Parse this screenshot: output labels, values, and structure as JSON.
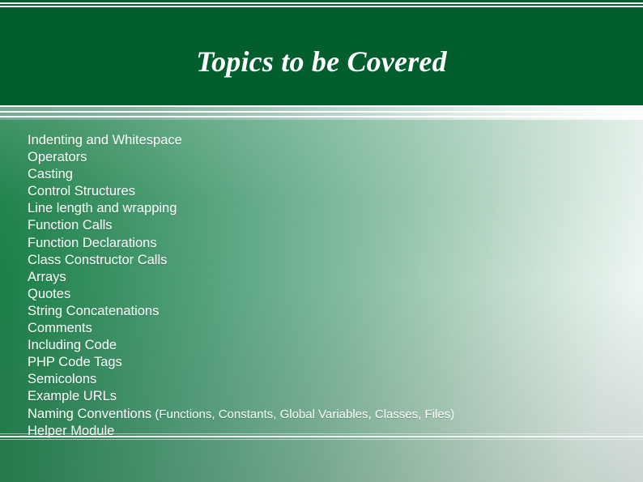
{
  "slide": {
    "title": "Topics to be Covered",
    "theme": {
      "header_green": "#035e2e",
      "body_green_dark": "#0f7a3f",
      "body_light": "#f7fbf9",
      "text_color": "#ffffff",
      "strip_sage": "#74ab93"
    },
    "topics": [
      {
        "label": "Indenting and Whitespace",
        "note": ""
      },
      {
        "label": "Operators",
        "note": ""
      },
      {
        "label": "Casting",
        "note": ""
      },
      {
        "label": "Control Structures",
        "note": ""
      },
      {
        "label": "Line length and wrapping",
        "note": ""
      },
      {
        "label": "Function Calls",
        "note": ""
      },
      {
        "label": "Function Declarations",
        "note": ""
      },
      {
        "label": "Class Constructor Calls",
        "note": ""
      },
      {
        "label": "Arrays",
        "note": ""
      },
      {
        "label": "Quotes",
        "note": ""
      },
      {
        "label": "String Concatenations",
        "note": ""
      },
      {
        "label": "Comments",
        "note": ""
      },
      {
        "label": "Including Code",
        "note": ""
      },
      {
        "label": "PHP Code Tags",
        "note": ""
      },
      {
        "label": "Semicolons",
        "note": ""
      },
      {
        "label": "Example URLs",
        "note": ""
      },
      {
        "label": "Naming Conventions",
        "note": " (Functions, Constants, Global Variables, Classes, Files)"
      },
      {
        "label": "Helper Module",
        "note": ""
      }
    ]
  }
}
